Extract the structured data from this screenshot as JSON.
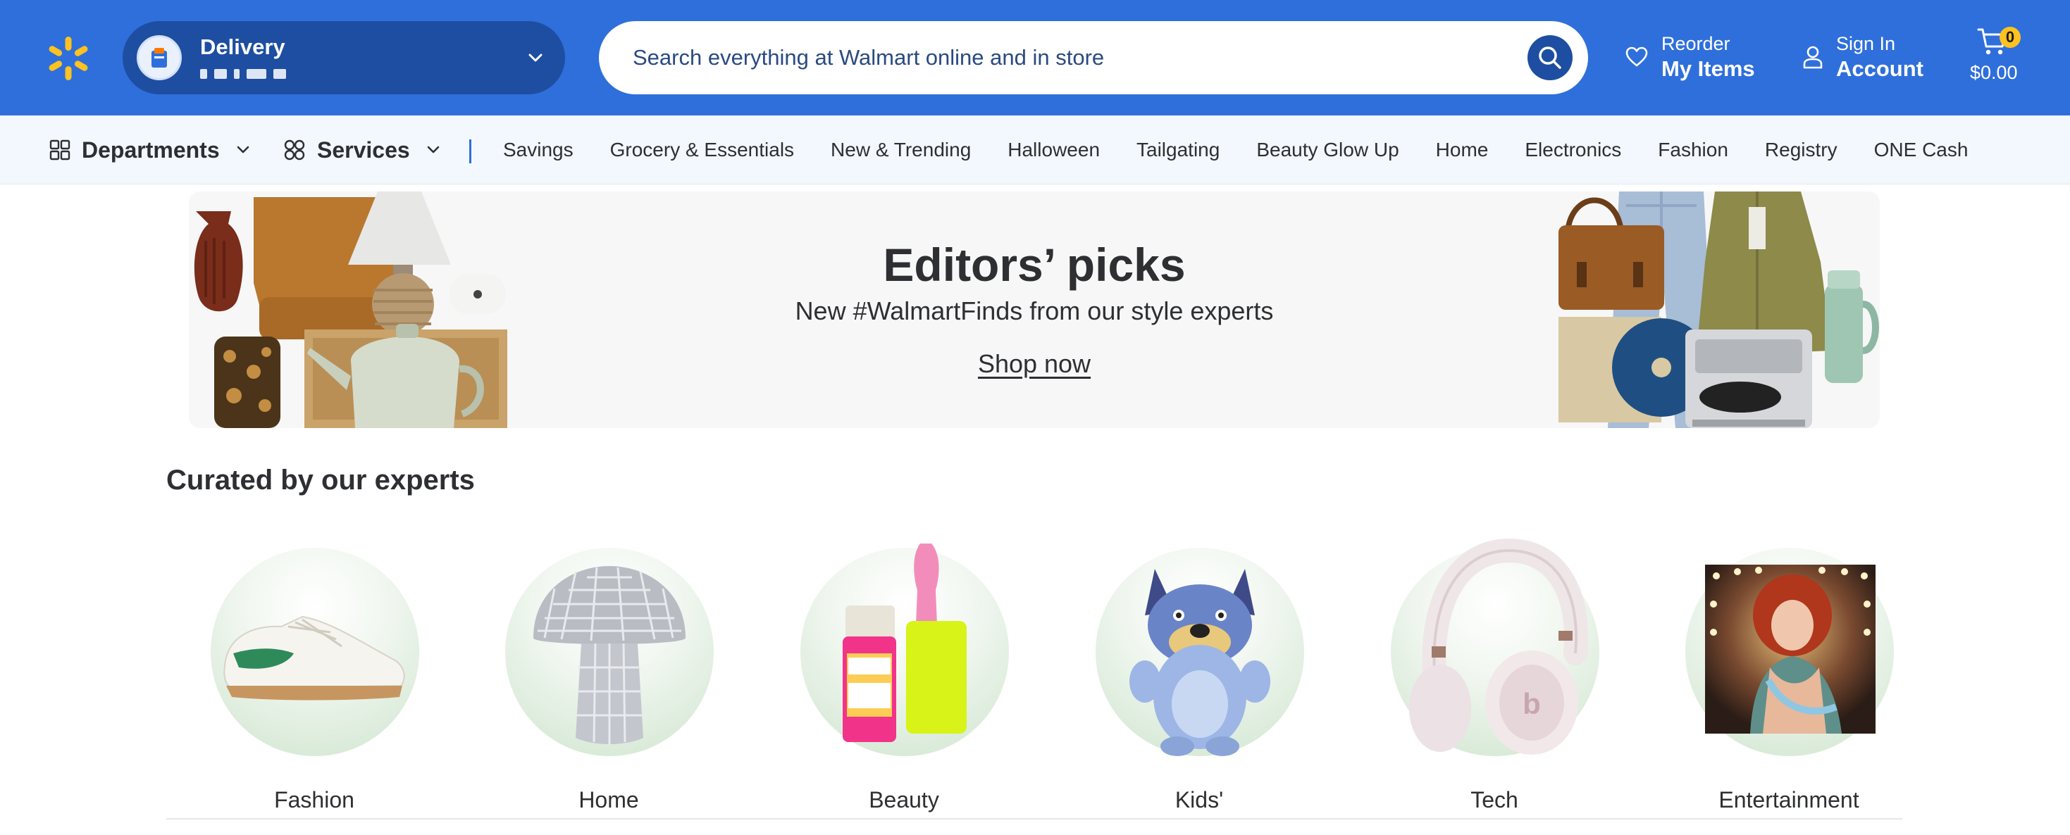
{
  "header": {
    "delivery": {
      "title": "Delivery"
    },
    "search": {
      "placeholder": "Search everything at Walmart online and in store"
    },
    "reorder": {
      "top": "Reorder",
      "bottom": "My Items"
    },
    "account": {
      "top": "Sign In",
      "bottom": "Account"
    },
    "cart": {
      "count": "0",
      "total": "$0.00"
    },
    "colors": {
      "brand_blue": "#2f6fdb",
      "dark_blue": "#1e4ea1",
      "spark_yellow": "#ffc220"
    }
  },
  "nav": {
    "departments_label": "Departments",
    "services_label": "Services",
    "links": [
      "Savings",
      "Grocery & Essentials",
      "New & Trending",
      "Halloween",
      "Tailgating",
      "Beauty Glow Up",
      "Home",
      "Electronics",
      "Fashion",
      "Registry",
      "ONE Cash"
    ]
  },
  "hero": {
    "title": "Editors’ picks",
    "subtitle": "New #WalmartFinds from our style experts",
    "cta": "Shop now"
  },
  "curated": {
    "title": "Curated by our experts",
    "categories": [
      {
        "label": "Fashion",
        "icon": "sneaker-icon"
      },
      {
        "label": "Home",
        "icon": "disco-mushroom-lamp-icon"
      },
      {
        "label": "Beauty",
        "icon": "lip-oil-icon"
      },
      {
        "label": "Kids'",
        "icon": "plush-toy-icon"
      },
      {
        "label": "Tech",
        "icon": "headphones-icon"
      },
      {
        "label": "Entertainment",
        "icon": "album-cover-icon"
      }
    ]
  }
}
